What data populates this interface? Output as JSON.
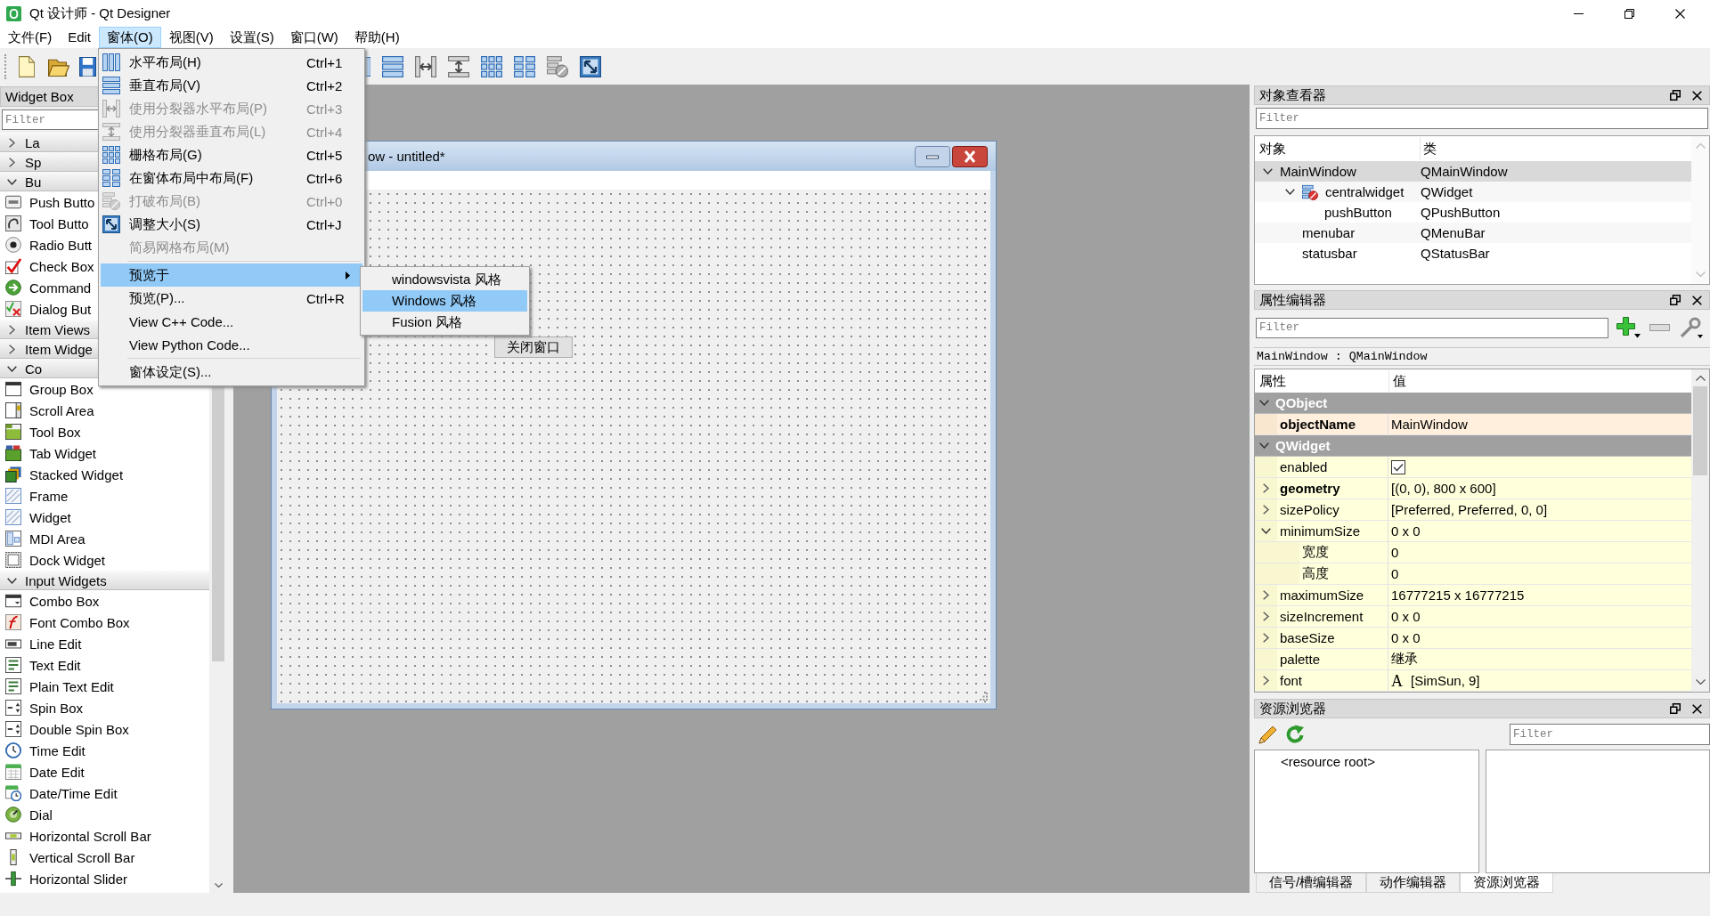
{
  "window": {
    "title": "Qt 设计师 - Qt Designer"
  },
  "menu_bar": [
    {
      "label": "文件(F)",
      "selected": false
    },
    {
      "label": "Edit",
      "selected": false
    },
    {
      "label": "窗体(O)",
      "selected": true
    },
    {
      "label": "视图(V)",
      "selected": false
    },
    {
      "label": "设置(S)",
      "selected": false
    },
    {
      "label": "窗口(W)",
      "selected": false
    },
    {
      "label": "帮助(H)",
      "selected": false
    }
  ],
  "open_menu": {
    "items": [
      {
        "kind": "item",
        "label": "水平布局(H)",
        "shortcut": "Ctrl+1",
        "disabled": false,
        "selected": false
      },
      {
        "kind": "item",
        "label": "垂直布局(V)",
        "shortcut": "Ctrl+2",
        "disabled": false,
        "selected": false
      },
      {
        "kind": "item",
        "label": "使用分裂器水平布局(P)",
        "shortcut": "Ctrl+3",
        "disabled": true,
        "selected": false
      },
      {
        "kind": "item",
        "label": "使用分裂器垂直布局(L)",
        "shortcut": "Ctrl+4",
        "disabled": true,
        "selected": false
      },
      {
        "kind": "item",
        "label": "栅格布局(G)",
        "shortcut": "Ctrl+5",
        "disabled": false,
        "selected": false
      },
      {
        "kind": "item",
        "label": "在窗体布局中布局(F)",
        "shortcut": "Ctrl+6",
        "disabled": false,
        "selected": false
      },
      {
        "kind": "item",
        "label": "打破布局(B)",
        "shortcut": "Ctrl+0",
        "disabled": true,
        "selected": false
      },
      {
        "kind": "item",
        "label": "调整大小(S)",
        "shortcut": "Ctrl+J",
        "disabled": false,
        "selected": false
      },
      {
        "kind": "item",
        "label": "简易网格布局(M)",
        "disabled": true,
        "selected": false
      },
      {
        "kind": "separator"
      },
      {
        "kind": "submenu",
        "label": "预览于",
        "disabled": false,
        "selected": true,
        "submenu": [
          {
            "label": "windowsvista 风格",
            "selected": false
          },
          {
            "label": "Windows 风格",
            "selected": true
          },
          {
            "label": "Fusion 风格",
            "selected": false
          }
        ]
      },
      {
        "kind": "item",
        "label": "预览(P)...",
        "shortcut": "Ctrl+R",
        "disabled": false,
        "selected": false
      },
      {
        "kind": "item",
        "label": "View C++ Code...",
        "disabled": false,
        "selected": false
      },
      {
        "kind": "item",
        "label": "View Python Code...",
        "disabled": false,
        "selected": false
      },
      {
        "kind": "separator"
      },
      {
        "kind": "item",
        "label": "窗体设定(S)...",
        "disabled": false,
        "selected": false
      }
    ]
  },
  "widget_box": {
    "title": "Widget Box",
    "filter": {
      "placeholder": "Filter"
    },
    "categories": [
      {
        "label": "La",
        "expanded": false
      },
      {
        "label": "Sp",
        "expanded": false
      },
      {
        "label": "Bu",
        "expanded": true,
        "items": [
          "Push Butto",
          "Tool Butto",
          "Radio Butt",
          "Check Box",
          "Command",
          "Dialog But"
        ]
      },
      {
        "label": "Item Views",
        "expanded": false
      },
      {
        "label": "Item Widge",
        "expanded": false
      },
      {
        "label": "Co",
        "expanded": true,
        "items": [
          "Group Box",
          "Scroll Area",
          "Tool Box",
          "Tab Widget",
          "Stacked Widget",
          "Frame",
          "Widget",
          "MDI Area",
          "Dock Widget"
        ]
      },
      {
        "label": "Input Widgets",
        "expanded": true,
        "items": [
          "Combo Box",
          "Font Combo Box",
          "Line Edit",
          "Text Edit",
          "Plain Text Edit",
          "Spin Box",
          "Double Spin Box",
          "Time Edit",
          "Date Edit",
          "Date/Time Edit",
          "Dial",
          "Horizontal Scroll Bar",
          "Vertical Scroll Bar",
          "Horizontal Slider"
        ]
      }
    ]
  },
  "form_window": {
    "title": "ow - untitled*",
    "button": "关闭窗口"
  },
  "object_inspector": {
    "title": "对象查看器",
    "filter": {
      "placeholder": "Filter"
    },
    "columns": [
      "对象",
      "类"
    ],
    "rows": [
      {
        "name": "MainWindow",
        "class": "QMainWindow",
        "no_layout": false,
        "selected": true,
        "expanded": true,
        "children": [
          {
            "name": "centralwidget",
            "class": "QWidget",
            "no_layout": true,
            "selected": false,
            "expanded": true,
            "children": [
              {
                "name": "pushButton",
                "class": "QPushButton",
                "no_layout": false,
                "selected": false
              }
            ]
          },
          {
            "name": "menubar",
            "class": "QMenuBar",
            "no_layout": false,
            "selected": false
          },
          {
            "name": "statusbar",
            "class": "QStatusBar",
            "no_layout": false,
            "selected": false
          }
        ]
      }
    ]
  },
  "property_editor": {
    "title": "属性编辑器",
    "filter": {
      "placeholder": "Filter"
    },
    "object_label": "MainWindow : QMainWindow",
    "columns": [
      "属性",
      "值"
    ],
    "groups": [
      {
        "name": "QObject",
        "expanded": true,
        "color": "#ffefdc",
        "properties": [
          {
            "name": "objectName",
            "kind": "text",
            "value": "MainWindow",
            "modified": true
          }
        ]
      },
      {
        "name": "QWidget",
        "expanded": true,
        "color": "#ffffdc",
        "properties": [
          {
            "name": "enabled",
            "kind": "checkbox",
            "checked": true,
            "modified": false
          },
          {
            "name": "geometry",
            "kind": "text",
            "value": "[(0, 0), 800 x 600]",
            "modified": true,
            "expanded": false
          },
          {
            "name": "sizePolicy",
            "kind": "text",
            "value": "[Preferred, Preferred, 0, 0]",
            "modified": false,
            "expanded": false
          },
          {
            "name": "minimumSize",
            "kind": "text",
            "value": "0 x 0",
            "modified": false,
            "expanded": true,
            "children": [
              {
                "name": "宽度",
                "kind": "text",
                "value": "0",
                "modified": false
              },
              {
                "name": "高度",
                "kind": "text",
                "value": "0",
                "modified": false
              }
            ]
          },
          {
            "name": "maximumSize",
            "kind": "text",
            "value": "16777215 x 16777215",
            "modified": false,
            "expanded": false
          },
          {
            "name": "sizeIncrement",
            "kind": "text",
            "value": "0 x 0",
            "modified": false,
            "expanded": false
          },
          {
            "name": "baseSize",
            "kind": "text",
            "value": "0 x 0",
            "modified": false,
            "expanded": false
          },
          {
            "name": "palette",
            "kind": "text",
            "value": "继承",
            "modified": false
          },
          {
            "name": "font",
            "kind": "font",
            "sample": "A",
            "value": "[SimSun, 9]",
            "modified": false,
            "expanded": false
          }
        ]
      }
    ]
  },
  "resource_browser": {
    "title": "资源浏览器",
    "filter": {
      "placeholder": "Filter"
    },
    "root": "<resource root>"
  },
  "bottom_tabs": [
    {
      "label": "信号/槽编辑器",
      "selected": false
    },
    {
      "label": "动作编辑器",
      "selected": false
    },
    {
      "label": "资源浏览器",
      "selected": true
    }
  ]
}
